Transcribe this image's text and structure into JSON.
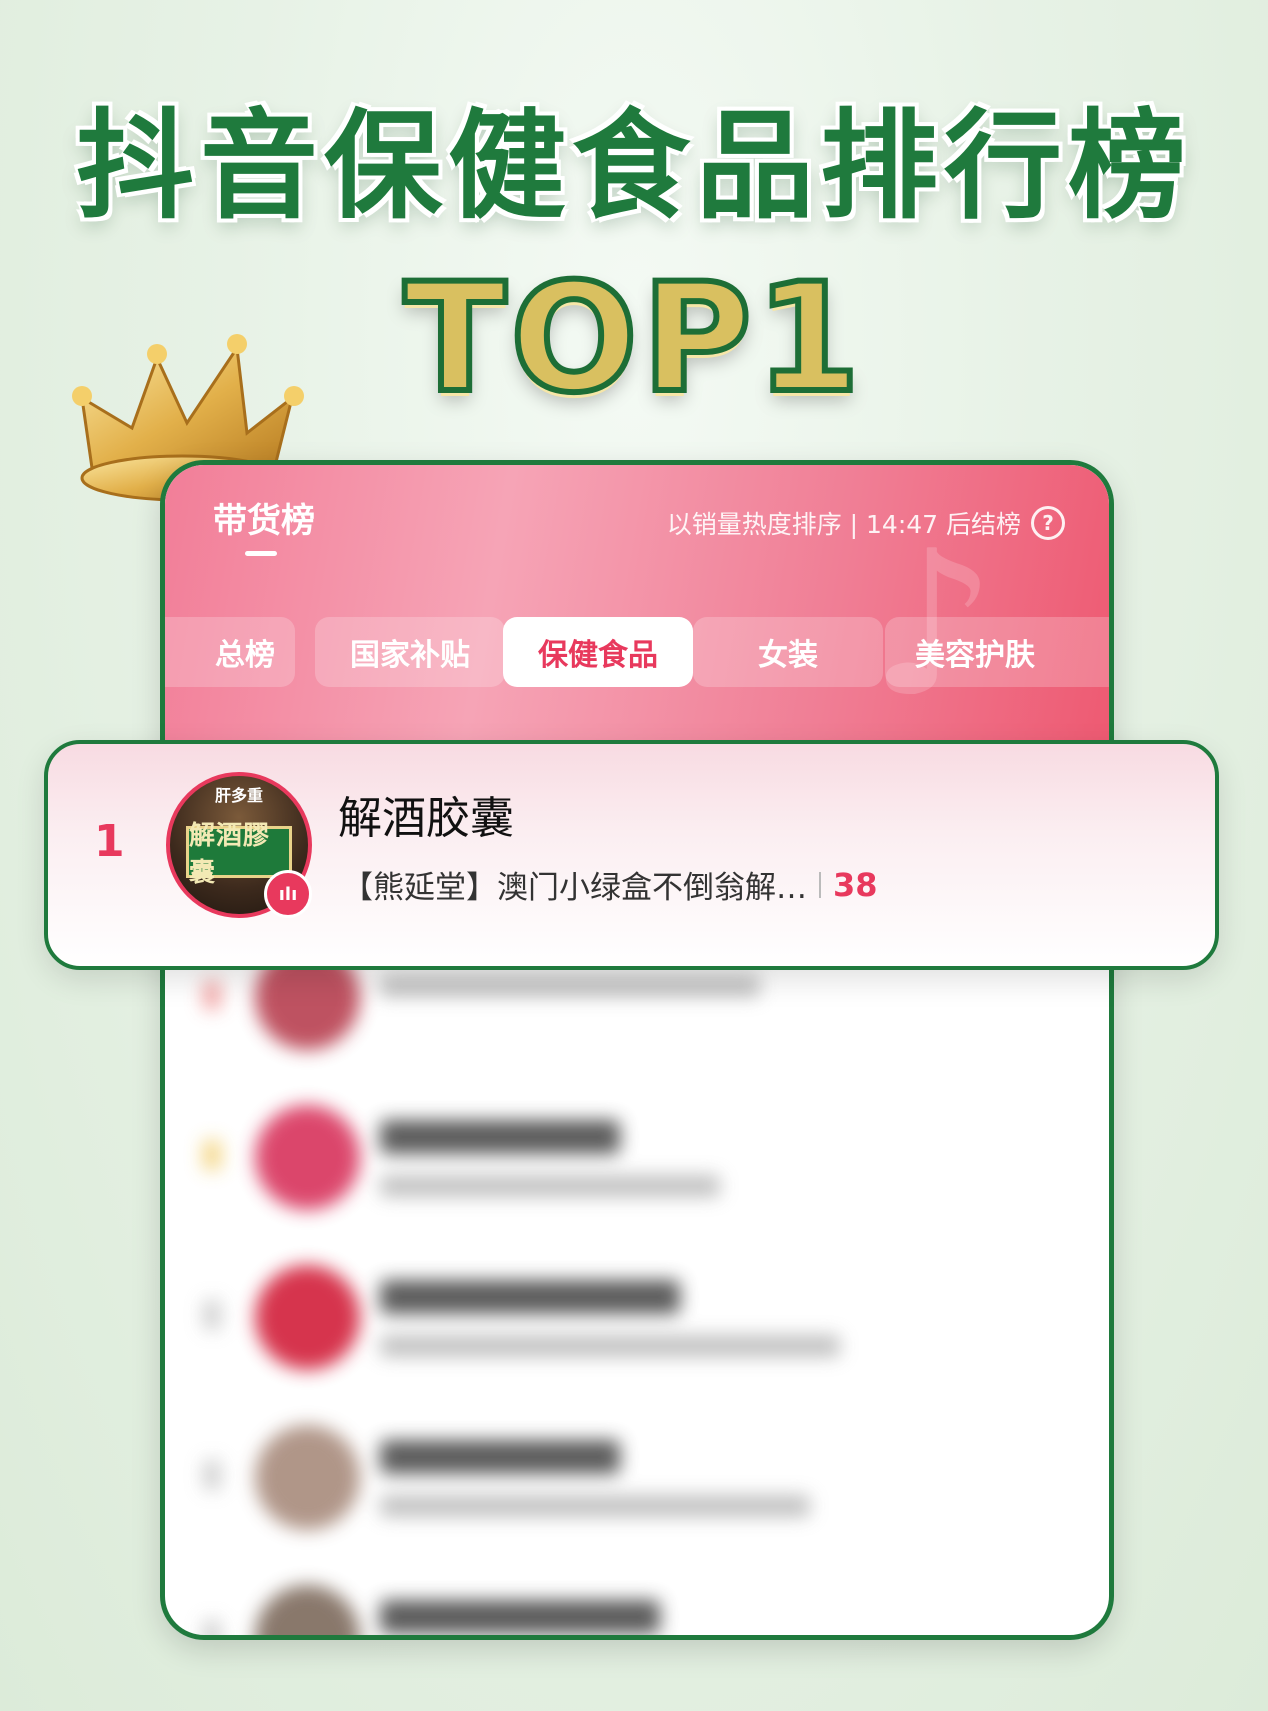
{
  "headline": "抖音保健食品排行榜",
  "badge": "TOP1",
  "panel": {
    "tab_title": "带货榜",
    "sort_info": "以销量热度排序 | 14:47 后结榜",
    "help": "?",
    "categories": [
      "总榜",
      "国家补贴",
      "保健食品",
      "女装",
      "美容护肤"
    ],
    "active_category": "保健食品"
  },
  "top_item": {
    "rank": "1",
    "name": "解酒胶囊",
    "description": "【熊延堂】澳门小绿盒不倒翁解…",
    "count": "38",
    "avatar_text_top": "肝多重",
    "avatar_sign": "解酒膠囊"
  },
  "colors": {
    "brand_green": "#1f7a3d",
    "accent_pink": "#e8395d"
  }
}
